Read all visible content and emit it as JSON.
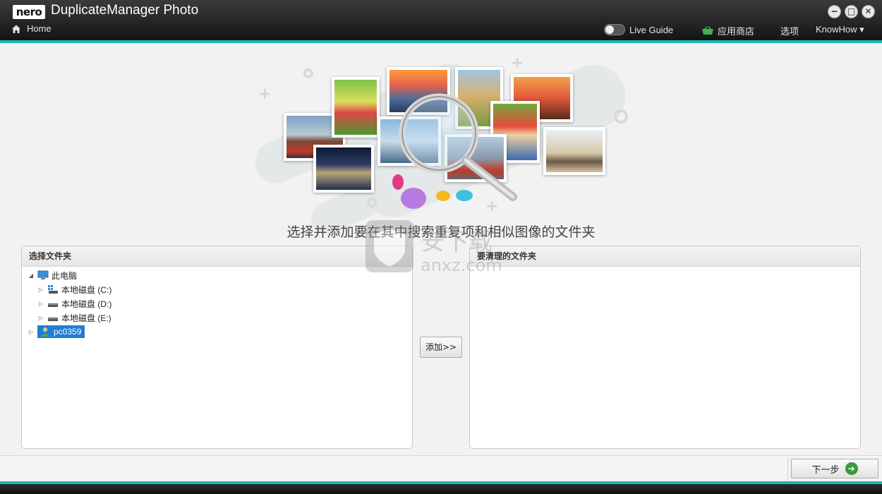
{
  "titlebar": {
    "logo": "nero",
    "title": "DuplicateManager Photo",
    "home": "Home",
    "live_guide": "Live Guide",
    "app_store": "应用商店",
    "options": "选项",
    "knowhow": "KnowHow ▾",
    "window_buttons": [
      "−",
      "□",
      "✕"
    ]
  },
  "hero": {
    "subtitle": "选择并添加要在其中搜索重复项和相似图像的文件夹"
  },
  "left_panel": {
    "header": "选择文件夹",
    "tree": {
      "root": "此电脑",
      "drives": [
        "本地磁盘 (C:)",
        "本地磁盘 (D:)",
        "本地磁盘 (E:)"
      ],
      "user": "pc0359"
    }
  },
  "add_button": "添加>>",
  "right_panel": {
    "header": "要清理的文件夹"
  },
  "watermark": {
    "text": "安下载",
    "domain": "anxz.com"
  },
  "footer": {
    "next": "下一步"
  },
  "colors": {
    "accent_teal": "#1fb5b5",
    "selection_blue": "#1e7fd6",
    "next_green": "#3a9a3a"
  }
}
